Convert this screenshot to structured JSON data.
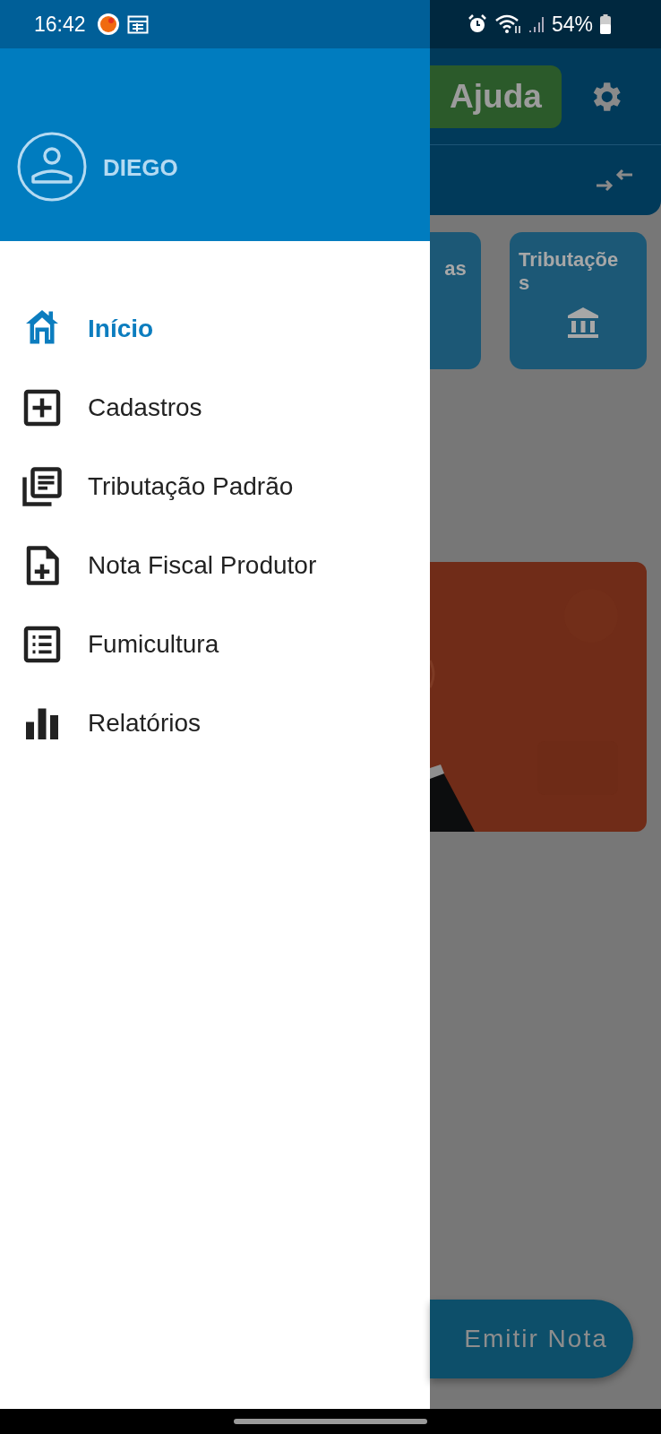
{
  "status_bar": {
    "time": "16:42",
    "battery": "54%"
  },
  "drawer": {
    "user_name": "DIEGO",
    "items": [
      {
        "label": "Início",
        "selected": true
      },
      {
        "label": "Cadastros",
        "selected": false
      },
      {
        "label": "Tributação Padrão",
        "selected": false
      },
      {
        "label": "Nota Fiscal Produtor",
        "selected": false
      },
      {
        "label": "Fumicultura",
        "selected": false
      },
      {
        "label": "Relatórios",
        "selected": false
      }
    ]
  },
  "background": {
    "help_button": "Ajuda",
    "cards": [
      {
        "label": "as"
      },
      {
        "label": "Tributações"
      }
    ],
    "fab": "Emitir Nota"
  }
}
